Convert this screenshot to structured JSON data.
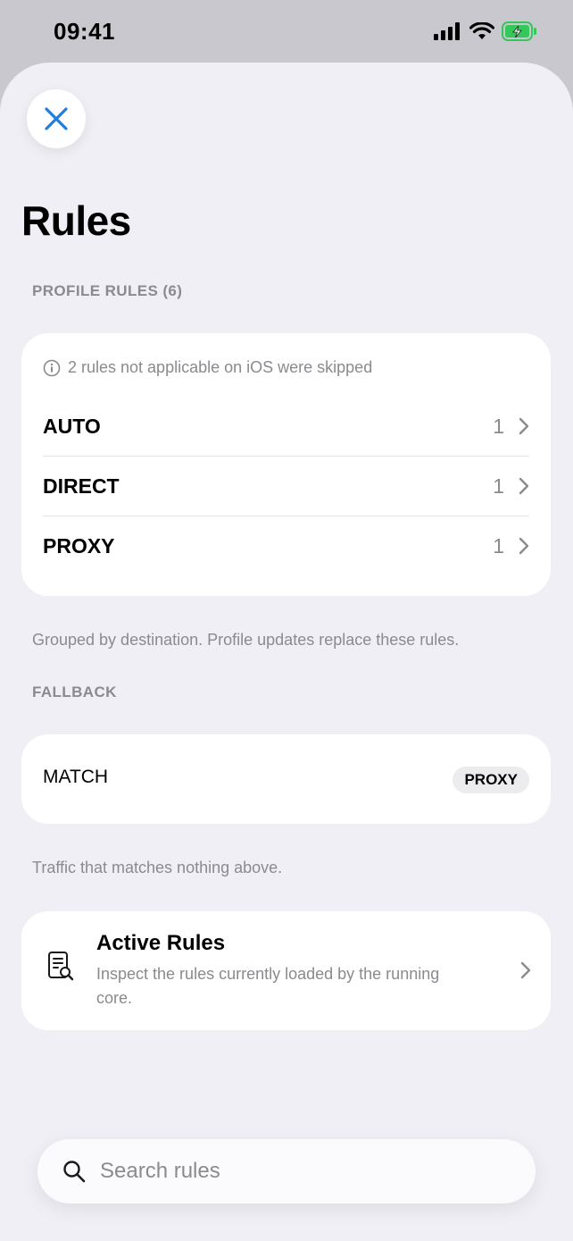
{
  "status_bar": {
    "time": "09:41"
  },
  "title": "Rules",
  "profile_section": {
    "header": "PROFILE RULES (6)",
    "note": "2 rules not applicable on iOS were skipped",
    "rows": [
      {
        "label": "AUTO",
        "count": "1"
      },
      {
        "label": "DIRECT",
        "count": "1"
      },
      {
        "label": "PROXY",
        "count": "1"
      }
    ],
    "footer": "Grouped by destination. Profile updates replace these rules."
  },
  "fallback_section": {
    "header": "FALLBACK",
    "match_label": "MATCH",
    "match_badge": "PROXY",
    "footer": "Traffic that matches nothing above."
  },
  "active_rules": {
    "title": "Active Rules",
    "description": "Inspect the rules currently loaded by the running core."
  },
  "search": {
    "placeholder": "Search rules",
    "value": ""
  },
  "colors": {
    "accent": "#1f7ee0",
    "secondary_text": "#8a8a8f",
    "battery": "#34c759",
    "background": "#f0eff5"
  }
}
